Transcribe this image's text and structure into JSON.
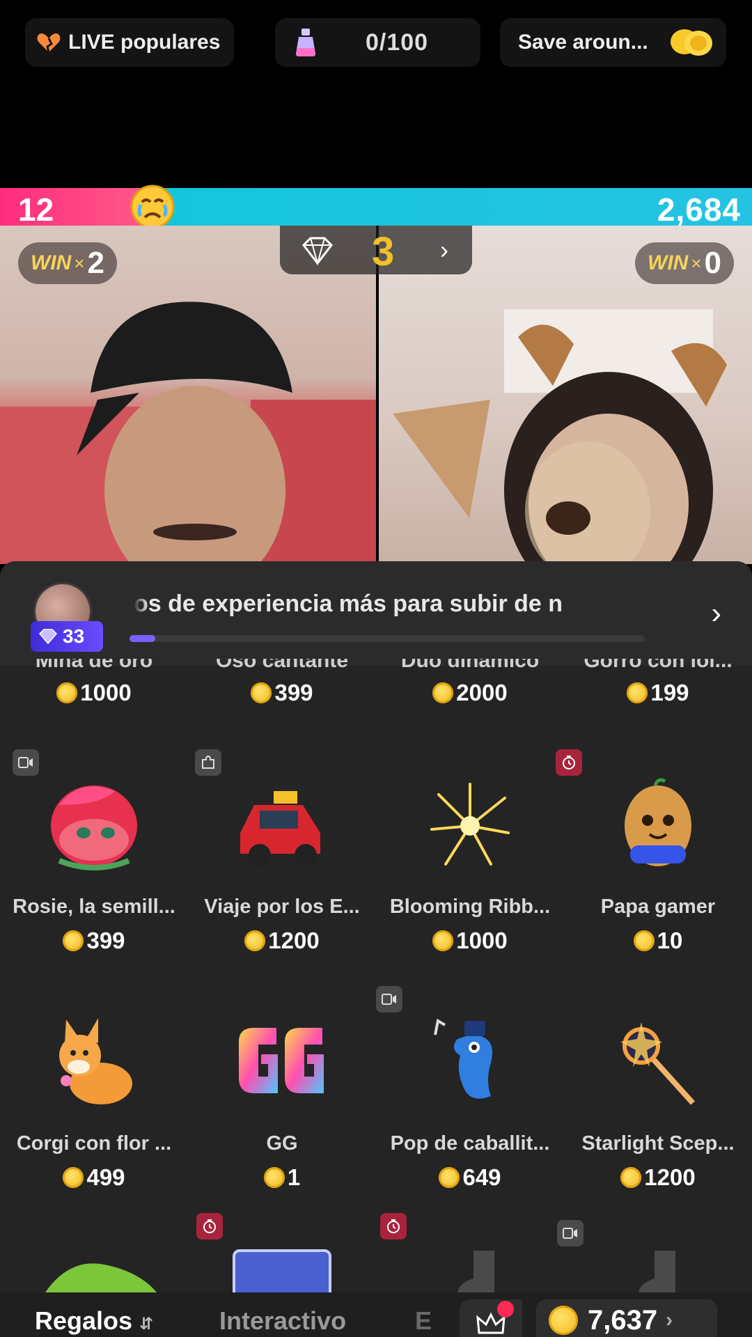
{
  "topbar": {
    "live_label": "LIVE populares",
    "counter": "0/100",
    "save_label": "Save aroun..."
  },
  "battle": {
    "left_score": "12",
    "right_score": "2,684",
    "left_share": 0.2,
    "left_win_label": "WIN",
    "left_win_mult": "×",
    "left_win_count": "2",
    "right_win_label": "WIN",
    "right_win_mult": "×",
    "right_win_count": "0",
    "round_number": "3"
  },
  "experience": {
    "level_badge": "33",
    "message": "os de experiencia más para subir de n",
    "progress": 0.05
  },
  "first_row_partial": {
    "names": [
      "Mina de oro",
      "Oso cantante",
      "Dúo dinámico",
      "Gorro con lol..."
    ],
    "prices": [
      "1000",
      "399",
      "2000",
      "199"
    ]
  },
  "gifts": [
    {
      "name": "Rosie, la semill...",
      "price": "399",
      "tag": "video"
    },
    {
      "name": "Viaje por los E...",
      "price": "1200",
      "tag": "puzzle"
    },
    {
      "name": "Blooming Ribb...",
      "price": "1000",
      "tag": ""
    },
    {
      "name": "Papa gamer",
      "price": "10",
      "tag": "timer"
    },
    {
      "name": "Corgi con flor ...",
      "price": "499",
      "tag": ""
    },
    {
      "name": "GG",
      "price": "1",
      "tag": ""
    },
    {
      "name": "Pop de caballit...",
      "price": "649",
      "tag": "video"
    },
    {
      "name": "Starlight Scep...",
      "price": "1200",
      "tag": ""
    }
  ],
  "tabs": {
    "active": "Regalos",
    "second": "Interactivo",
    "third_partial": "E",
    "balance": "7,637"
  },
  "colors": {
    "pink": "#ff2c7d",
    "cyan": "#1ec6de",
    "gold": "#f2c028",
    "panel": "#242424",
    "badge_purple": "#5a40f0"
  }
}
